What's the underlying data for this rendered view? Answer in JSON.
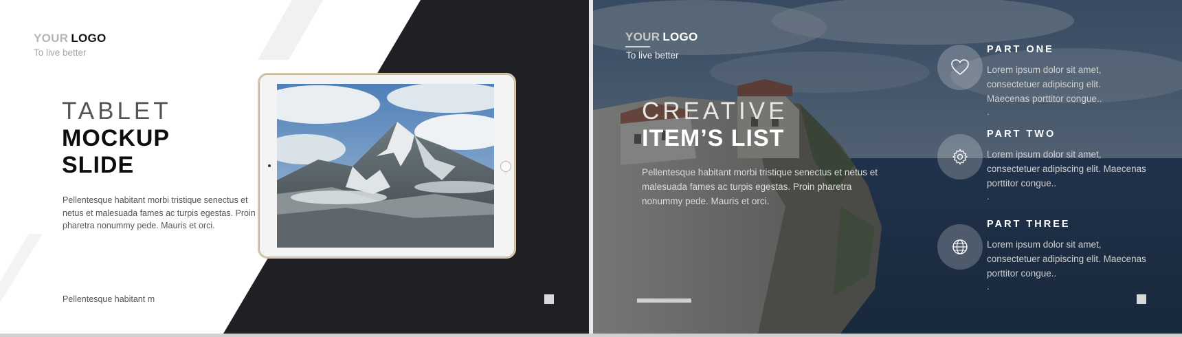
{
  "left_slide": {
    "logo": {
      "your": "YOUR",
      "word": "LOGO"
    },
    "tagline": "To live better",
    "title_thin": "TABLET",
    "title_bold_1": "MOCKUP",
    "title_bold_2": "SLIDE",
    "body_lines": [
      "Pellentesque habitant morbi tristique senectus et",
      "netus et malesuada fames ac turpis egestas. Proin",
      "pharetra nonummy pede. Mauris et orci."
    ],
    "footnote": "Pellentesque habitant m",
    "dark_color": "#1f2024"
  },
  "right_slide": {
    "logo": {
      "your": "YOUR",
      "word": "LOGO"
    },
    "tagline": "To live better",
    "title_thin": "CREATIVE",
    "title_bold": "ITEM’S LIST",
    "body_lines": [
      "Pellentesque habitant morbi tristique senectus et netus et",
      "malesuada fames ac turpis egestas. Proin pharetra",
      "nonummy pede. Mauris et orci."
    ],
    "parts": [
      {
        "title": "PART ONE",
        "icon": "heart-icon",
        "lines": [
          "Lorem ipsum dolor sit amet,",
          "consectetuer adipiscing elit.",
          "Maecenas porttitor congue.."
        ],
        "dot": "."
      },
      {
        "title": "PART TWO",
        "icon": "gear-icon",
        "lines": [
          "Lorem ipsum dolor sit amet,",
          "consectetuer adipiscing elit. Maecenas",
          "porttitor congue.."
        ],
        "dot": "."
      },
      {
        "title": "PART THREE",
        "icon": "globe-icon",
        "lines": [
          "Lorem ipsum dolor sit amet,",
          "consectetuer adipiscing elit. Maecenas",
          "porttitor congue.."
        ],
        "dot": "."
      }
    ]
  }
}
